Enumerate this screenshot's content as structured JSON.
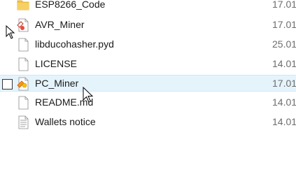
{
  "files": [
    {
      "name": "ESP8266_Code",
      "date": "17.01",
      "icon": "folder-icon"
    },
    {
      "name": "AVR_Miner",
      "date": "17.01",
      "icon": "python-script-icon"
    },
    {
      "name": "libducohasher.pyd",
      "date": "25.01",
      "icon": "document-icon"
    },
    {
      "name": "LICENSE",
      "date": "14.01",
      "icon": "document-icon"
    },
    {
      "name": "PC_Miner",
      "date": "17.01",
      "icon": "python-script-icon"
    },
    {
      "name": "README.md",
      "date": "14.01",
      "icon": "document-icon"
    },
    {
      "name": "Wallets notice",
      "date": "14.01",
      "icon": "text-document-icon"
    }
  ],
  "selected_row": "PC_Miner",
  "colors": {
    "hover_bg": "#e5f3fb",
    "hover_border": "#cce8ff",
    "folder": "#f3c244",
    "date_text": "#6d6d6d"
  }
}
